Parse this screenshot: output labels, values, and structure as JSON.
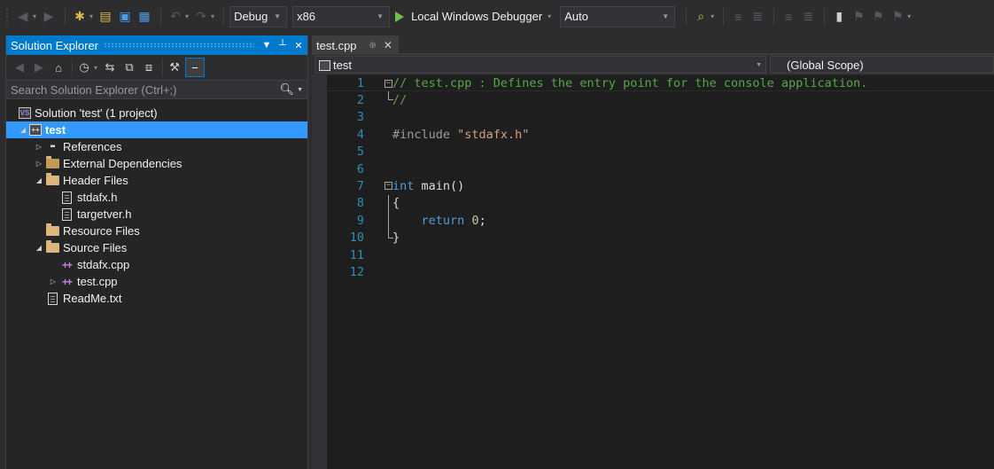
{
  "toolbar": {
    "configuration": "Debug",
    "platform": "x86",
    "run_label": "Local Windows Debugger",
    "solution_config": "Auto",
    "icons": [
      "back-icon",
      "forward-icon",
      "new-project-icon",
      "open-icon",
      "save-icon",
      "save-all-icon",
      "undo-icon",
      "redo-icon",
      "start-icon",
      "find-icon",
      "comment-icon",
      "uncomment-icon",
      "bookmark-icon"
    ]
  },
  "solution_explorer": {
    "title": "Solution Explorer",
    "search_placeholder": "Search Solution Explorer (Ctrl+;)",
    "tree": [
      {
        "label": "Solution 'test' (1 project)",
        "depth": 0,
        "expander": "",
        "icon": "solution-icon"
      },
      {
        "label": "test",
        "depth": 1,
        "expander": "expanded",
        "icon": "project-icon",
        "selected": true
      },
      {
        "label": "References",
        "depth": 2,
        "expander": "collapsed",
        "icon": "references-icon"
      },
      {
        "label": "External Dependencies",
        "depth": 2,
        "expander": "collapsed",
        "icon": "external-deps-icon"
      },
      {
        "label": "Header Files",
        "depth": 2,
        "expander": "expanded",
        "icon": "folder-icon"
      },
      {
        "label": "stdafx.h",
        "depth": 3,
        "expander": "",
        "icon": "header-file-icon"
      },
      {
        "label": "targetver.h",
        "depth": 3,
        "expander": "",
        "icon": "header-file-icon"
      },
      {
        "label": "Resource Files",
        "depth": 2,
        "expander": "",
        "icon": "folder-icon"
      },
      {
        "label": "Source Files",
        "depth": 2,
        "expander": "expanded",
        "icon": "folder-icon"
      },
      {
        "label": "stdafx.cpp",
        "depth": 3,
        "expander": "",
        "icon": "cpp-file-icon"
      },
      {
        "label": "test.cpp",
        "depth": 3,
        "expander": "collapsed",
        "icon": "cpp-file-icon"
      },
      {
        "label": "ReadMe.txt",
        "depth": 2,
        "expander": "",
        "icon": "text-file-icon"
      }
    ]
  },
  "editor": {
    "tab_title": "test.cpp",
    "nav_project": "test",
    "nav_scope": "(Global Scope)",
    "lines": [
      {
        "n": "1",
        "tokens": [
          {
            "t": "// test.cpp : Defines the entry point for the console application.",
            "c": "comment"
          }
        ]
      },
      {
        "n": "2",
        "tokens": [
          {
            "t": "//",
            "c": "comment"
          }
        ]
      },
      {
        "n": "3",
        "tokens": []
      },
      {
        "n": "4",
        "tokens": [
          {
            "t": "#include ",
            "c": "pre"
          },
          {
            "t": "\"stdafx.h\"",
            "c": "str"
          }
        ]
      },
      {
        "n": "5",
        "tokens": []
      },
      {
        "n": "6",
        "tokens": []
      },
      {
        "n": "7",
        "tokens": [
          {
            "t": "int",
            "c": "kw"
          },
          {
            "t": " main()",
            "c": "txt"
          }
        ]
      },
      {
        "n": "8",
        "tokens": [
          {
            "t": "{",
            "c": "txt"
          }
        ]
      },
      {
        "n": "9",
        "tokens": [
          {
            "t": "    ",
            "c": "txt"
          },
          {
            "t": "return",
            "c": "kw"
          },
          {
            "t": " ",
            "c": "txt"
          },
          {
            "t": "0",
            "c": "num"
          },
          {
            "t": ";",
            "c": "txt"
          }
        ]
      },
      {
        "n": "10",
        "tokens": [
          {
            "t": "}",
            "c": "txt"
          }
        ]
      },
      {
        "n": "11",
        "tokens": []
      },
      {
        "n": "12",
        "tokens": []
      }
    ]
  },
  "colors": {
    "accent": "#007acc",
    "selection": "#3399ff",
    "editor_bg": "#1e1e1e",
    "line_number": "#2b91af",
    "comment": "#57a64a",
    "keyword": "#569cd6",
    "string": "#d69d85"
  }
}
